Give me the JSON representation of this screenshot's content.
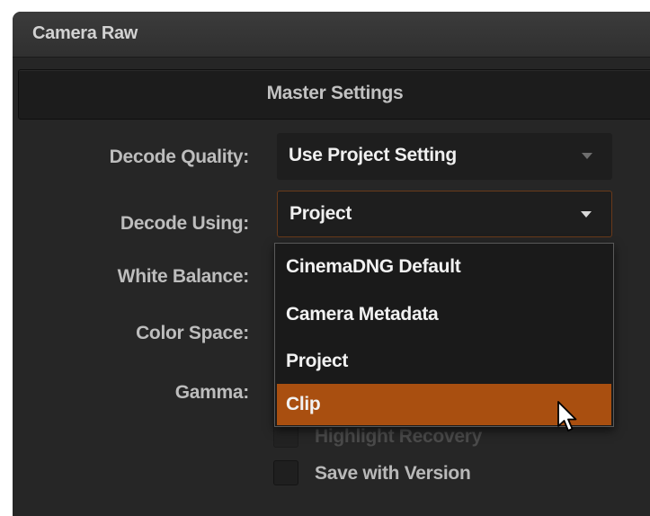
{
  "panel": {
    "title": "Camera Raw",
    "section_title": "Master Settings"
  },
  "fields": {
    "decode_quality": {
      "label": "Decode Quality:",
      "value": "Use Project Setting"
    },
    "decode_using": {
      "label": "Decode Using:",
      "value": "Project"
    },
    "white_balance": {
      "label": "White Balance:"
    },
    "color_space": {
      "label": "Color Space:"
    },
    "gamma": {
      "label": "Gamma:"
    }
  },
  "dropdown": {
    "options": [
      "CinemaDNG Default",
      "Camera Metadata",
      "Project",
      "Clip"
    ],
    "highlighted": "Clip"
  },
  "checkboxes": {
    "highlight_recovery": {
      "label": "Highlight Recovery",
      "checked": false,
      "enabled": false
    },
    "save_with_version": {
      "label": "Save with Version",
      "checked": false,
      "enabled": true
    }
  },
  "colors": {
    "panel_bg": "#262626",
    "highlight": "#a94f10",
    "text": "#f0f0f0"
  }
}
